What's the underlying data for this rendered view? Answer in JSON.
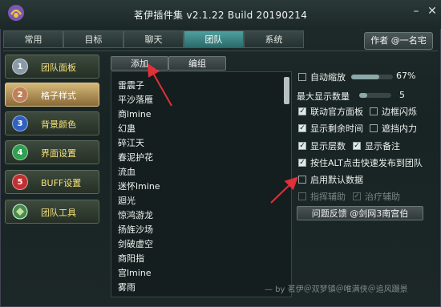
{
  "window": {
    "title": "茗伊插件集 v2.1.22 Build 20190214"
  },
  "tabs": [
    {
      "label": "常用"
    },
    {
      "label": "目标"
    },
    {
      "label": "聊天"
    },
    {
      "label": "团队"
    },
    {
      "label": "系统"
    }
  ],
  "author_button": "作者 @一名宅",
  "sidebar": {
    "items": [
      {
        "num": "1",
        "label": "团队面板",
        "color": "#9ab"
      },
      {
        "num": "2",
        "label": "格子样式",
        "color": "#c87"
      },
      {
        "num": "3",
        "label": "背景颜色",
        "color": "#37c"
      },
      {
        "num": "4",
        "label": "界面设置",
        "color": "#3a5"
      },
      {
        "num": "5",
        "label": "BUFF设置",
        "color": "#c33"
      },
      {
        "num": "",
        "label": "团队工具",
        "color": "#6a6"
      }
    ]
  },
  "buttons": {
    "add": "添加",
    "edit": "编组"
  },
  "list": [
    "雷震子",
    "平沙落雁",
    "商lmine",
    "幻蛊",
    "碎江天",
    "春泥护花",
    "流血",
    "迷怀lmine",
    "廻光",
    "惊鸿游龙",
    "扬旌沙场",
    "剑破虚空",
    "商阳指",
    "宫lmine",
    "雾雨"
  ],
  "options": {
    "auto_scale_label": "自动缩放",
    "auto_scale_value": "67%",
    "max_display_label": "最大显示数量",
    "max_display_value": "5",
    "link_panel": "联动官方面板",
    "border_flash": "边框闪烁",
    "show_remaining_time": "显示剩余时间",
    "mask_inner": "遮挡内力",
    "show_layers": "显示层数",
    "show_note": "显示备注",
    "alt_click_publish": "按住ALT点击快速发布到团队",
    "enable_default_data": "启用默认数据",
    "command_assist": "指挥辅助",
    "heal_assist": "治疗辅助"
  },
  "feedback_button": "问题反馈 @剑网3南宫伯",
  "footer": "— by 茗伊＠双梦镇＠唯满侠＠追风蹑景",
  "colors": {
    "accent": "#e0303a",
    "active_tab": "#3c8888",
    "gold": "#f6e27a"
  }
}
